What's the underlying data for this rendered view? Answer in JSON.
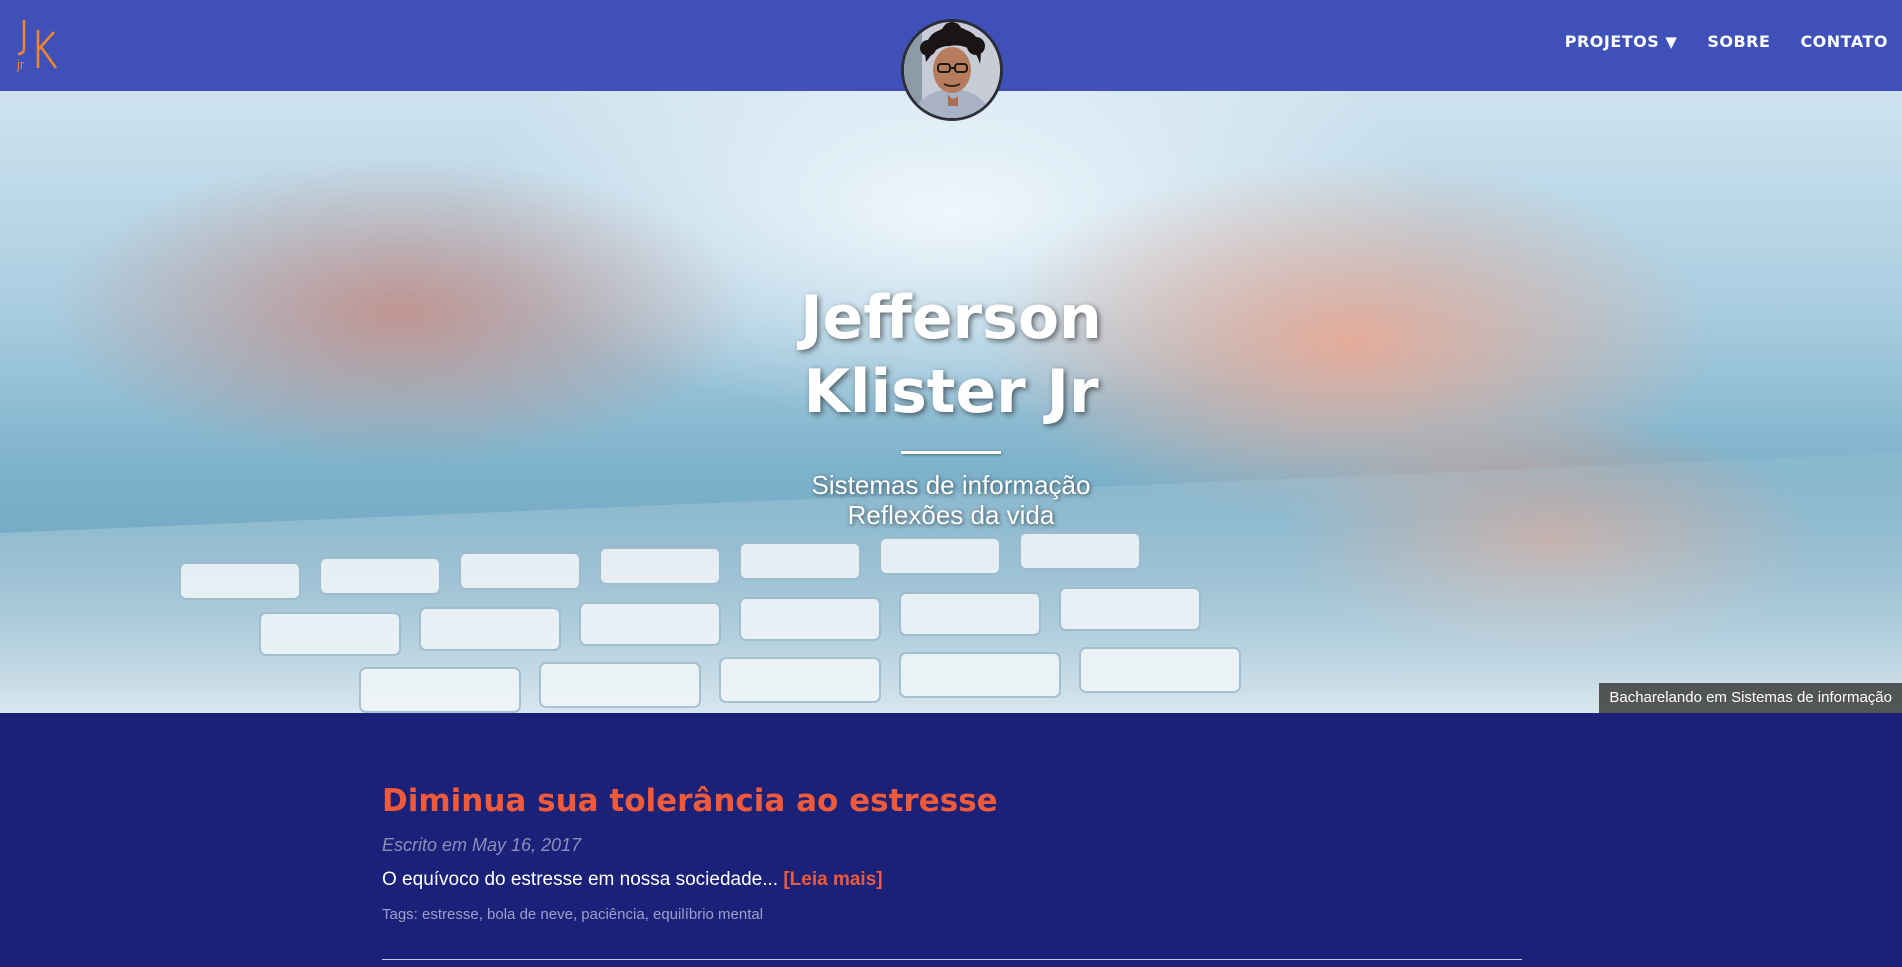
{
  "header": {
    "logo_text": "JK",
    "logo_sub": "jr",
    "nav": [
      {
        "label": "PROJETOS",
        "caret": "▼"
      },
      {
        "label": "SOBRE"
      },
      {
        "label": "CONTATO"
      }
    ]
  },
  "hero": {
    "title_line1": "Jefferson",
    "title_line2": "Klister Jr",
    "subtitle_line1": "Sistemas de informação",
    "subtitle_line2": "Reflexões da vida",
    "caption": "Bacharelando em Sistemas de informação"
  },
  "post": {
    "title": "Diminua sua tolerância ao estresse",
    "date": "Escrito em May 16, 2017",
    "excerpt": "O equívoco do estresse em nossa sociedade...",
    "read_more": "[Leia mais]",
    "tags": "Tags: estresse, bola de neve, paciência, equilíbrio mental"
  },
  "colors": {
    "header_bg": "#3f51b8",
    "page_bg": "#1b2178",
    "accent": "#ef5a3a",
    "logo": "#f0842c"
  }
}
